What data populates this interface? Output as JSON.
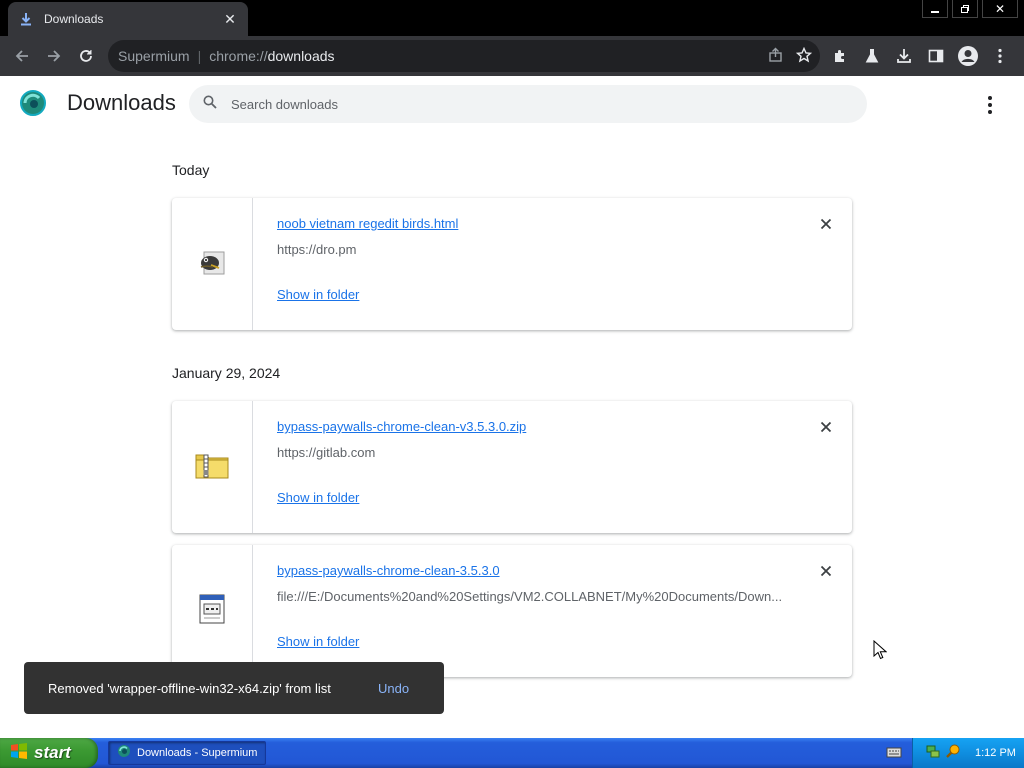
{
  "browser": {
    "tab_title": "Downloads",
    "omnibox_brand": "Supermium",
    "omnibox_separator": "|",
    "omnibox_url_scheme": "chrome://",
    "omnibox_url_path": "downloads"
  },
  "page": {
    "title": "Downloads",
    "search_placeholder": "Search downloads"
  },
  "groups": [
    {
      "date": "Today",
      "items": [
        {
          "file_name": "noob vietnam regedit birds.html",
          "source": "https://dro.pm",
          "action": "Show in folder",
          "icon": "html-file-icon"
        }
      ]
    },
    {
      "date": "January 29, 2024",
      "items": [
        {
          "file_name": "bypass-paywalls-chrome-clean-v3.5.3.0.zip",
          "source": "https://gitlab.com",
          "action": "Show in folder",
          "icon": "zip-folder-icon"
        },
        {
          "file_name": "bypass-paywalls-chrome-clean-3.5.3.0",
          "source": "file:///E:/Documents%20and%20Settings/VM2.COLLABNET/My%20Documents/Down...",
          "action": "Show in folder",
          "icon": "generic-file-icon"
        }
      ]
    }
  ],
  "toast": {
    "message": "Removed 'wrapper-offline-win32-x64.zip' from list",
    "action": "Undo"
  },
  "taskbar": {
    "start_label": "start",
    "task_label": "Downloads - Supermium",
    "clock": "1:12 PM"
  },
  "colors": {
    "link": "#1a73e8",
    "toolbar": "#35363a",
    "toast_bg": "#323232",
    "toast_action": "#8ab4f8"
  }
}
